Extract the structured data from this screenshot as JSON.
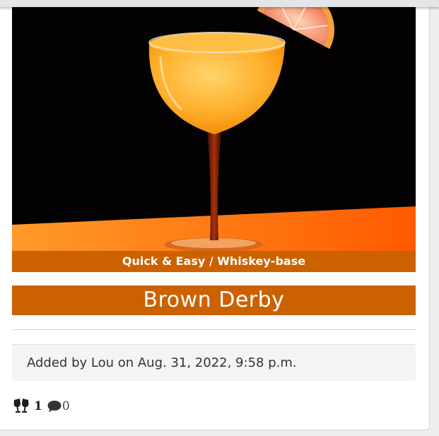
{
  "recipe": {
    "category": "Quick & Easy / Whiskey-base",
    "title": "Brown Derby",
    "added_by": "Added by Lou on Aug. 31, 2022, 9:58 p.m."
  },
  "stats": {
    "likes": "1",
    "comments": "0"
  },
  "colors": {
    "accent": "#cc6100",
    "card_bg": "#ffffff",
    "meta_bg": "#f4f4f4"
  },
  "icons": {
    "likes": "cheers-glasses-icon",
    "comments": "comment-bubble-icon"
  }
}
